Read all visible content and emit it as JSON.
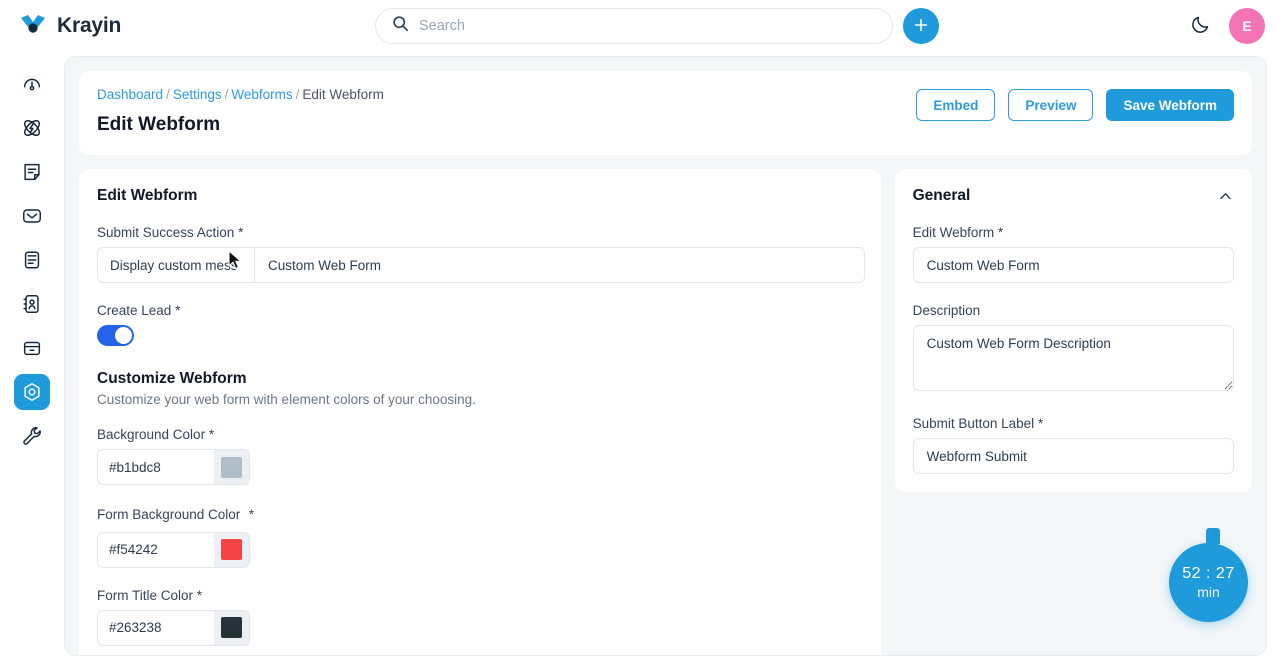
{
  "brand": {
    "name": "Krayin",
    "logo_icon": "krayin-logo-icon"
  },
  "topbar": {
    "search": {
      "placeholder": "Search",
      "value": "",
      "icon": "search-icon"
    },
    "add_button": {
      "icon": "plus-icon",
      "label": ""
    },
    "theme_toggle": {
      "icon": "moon-icon"
    },
    "avatar": {
      "initial": "E"
    }
  },
  "sidebar": {
    "items": [
      {
        "name": "dashboard",
        "icon": "gauge-icon",
        "active": false
      },
      {
        "name": "leads",
        "icon": "atom-icon",
        "active": false
      },
      {
        "name": "quotes",
        "icon": "document-icon",
        "active": false
      },
      {
        "name": "mail",
        "icon": "mail-icon",
        "active": false
      },
      {
        "name": "activities",
        "icon": "clipboard-icon",
        "active": false
      },
      {
        "name": "contacts",
        "icon": "contact-card-icon",
        "active": false
      },
      {
        "name": "products",
        "icon": "box-icon",
        "active": false
      },
      {
        "name": "settings",
        "icon": "hexagon-gear-icon",
        "active": true
      },
      {
        "name": "configuration",
        "icon": "wrench-icon",
        "active": false
      }
    ]
  },
  "header": {
    "breadcrumb": [
      {
        "label": "Dashboard",
        "link": true
      },
      {
        "label": "Settings",
        "link": true
      },
      {
        "label": "Webforms",
        "link": true
      },
      {
        "label": "Edit Webform",
        "link": false
      }
    ],
    "separator": "/",
    "title": "Edit Webform",
    "actions": {
      "embed": "Embed",
      "preview": "Preview",
      "save": "Save Webform"
    }
  },
  "left_panel": {
    "title": "Edit Webform",
    "submit_success_action": {
      "label": "Submit Success Action",
      "required": "*",
      "select_value": "Display custom mess",
      "text_value": "Custom Web Form",
      "chevron_icon": "chevron-down-icon"
    },
    "create_lead": {
      "label": "Create Lead",
      "required": "*",
      "enabled": true
    },
    "customize": {
      "heading": "Customize Webform",
      "description": "Customize your web form with element colors of your choosing.",
      "colors": [
        {
          "label": "Background Color",
          "required": "*",
          "value": "#b1bdc8",
          "swatch": "#b1bdc8"
        },
        {
          "label": "Form Background Color",
          "required": "*",
          "value": "#f54242",
          "swatch": "#f54242"
        },
        {
          "label": "Form Title Color",
          "required": "*",
          "value": "#263238",
          "swatch": "#263238"
        }
      ]
    }
  },
  "right_panel": {
    "title": "General",
    "collapse_icon": "chevron-up-icon",
    "fields": {
      "edit_webform": {
        "label": "Edit Webform",
        "required": "*",
        "value": "Custom Web Form"
      },
      "description": {
        "label": "Description",
        "required": "",
        "value": "Custom Web Form Description"
      },
      "submit_button_label": {
        "label": "Submit Button Label",
        "required": "*",
        "value": "Webform Submit"
      }
    }
  },
  "timer": {
    "time": "52 : 27",
    "unit": "min"
  },
  "colors": {
    "accent": "#1f9ada",
    "link": "#2e9bdc",
    "toggle_on": "#2563eb",
    "avatar_bg": "#f472b6",
    "page_bg": "#f4f6f8"
  }
}
